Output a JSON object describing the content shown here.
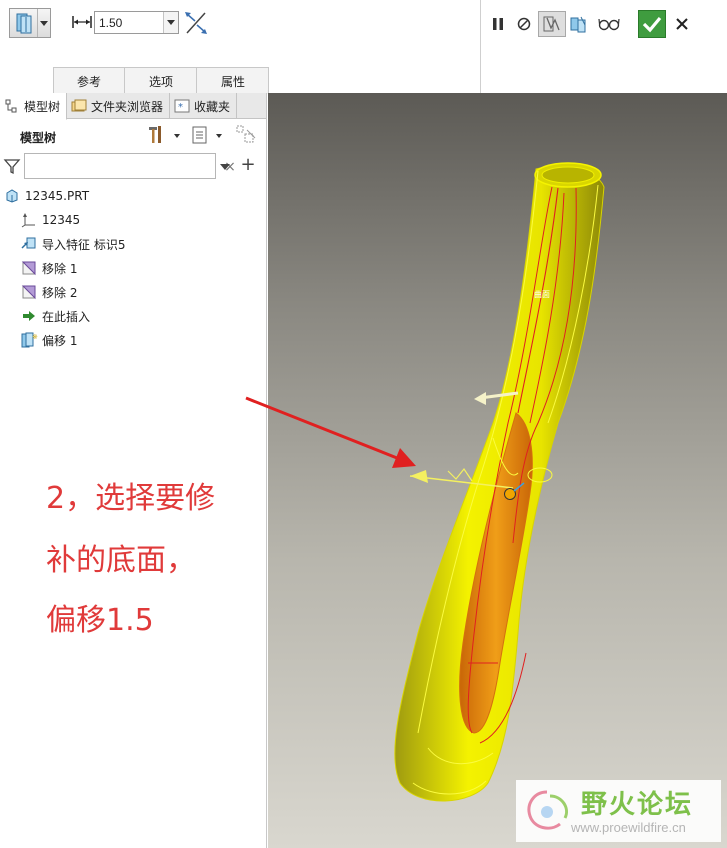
{
  "dashboard": {
    "offset_type_icon": "offset-surface-icon",
    "distance_icon": "distance-icon",
    "distance_value": "1.50",
    "flip_icon": "flip-direction-icon",
    "tabs": [
      {
        "label": "参考"
      },
      {
        "label": "选项"
      },
      {
        "label": "属性"
      }
    ],
    "tools": {
      "pause_icon": "pause-icon",
      "stop_icon": "stop-preview-icon",
      "preview_icon": "feature-preview-icon",
      "verify_icon": "verify-icon",
      "glasses_icon": "glasses-icon",
      "ok_icon": "check-icon",
      "cancel_icon": "close-icon"
    }
  },
  "navigator": {
    "tabs": [
      {
        "label": "模型树",
        "icon": "model-tree-icon"
      },
      {
        "label": "文件夹浏览器",
        "icon": "folder-icon"
      },
      {
        "label": "收藏夹",
        "icon": "favorites-icon"
      }
    ],
    "title": "模型树",
    "filter_placeholder": "",
    "tree": [
      {
        "label": "12345.PRT",
        "icon": "part-icon"
      },
      {
        "label": "12345",
        "icon": "csys-icon"
      },
      {
        "label": "导入特征 标识5",
        "icon": "import-feature-icon"
      },
      {
        "label": "移除 1",
        "icon": "remove-icon"
      },
      {
        "label": "移除 2",
        "icon": "remove-icon"
      },
      {
        "label": "在此插入",
        "icon": "insert-here-icon"
      },
      {
        "label": "偏移 1",
        "icon": "offset-icon"
      }
    ]
  },
  "annotation": {
    "lines": [
      "2，选择要修",
      "补的底面，",
      "偏移1.5"
    ],
    "color": "#e03a3a"
  },
  "graphics": {
    "surface_label": "曲面",
    "body_color": "#f2f000",
    "selected_color": "#e8860c"
  },
  "watermark": {
    "title": "野火论坛",
    "url": "www.proewildfire.cn"
  }
}
